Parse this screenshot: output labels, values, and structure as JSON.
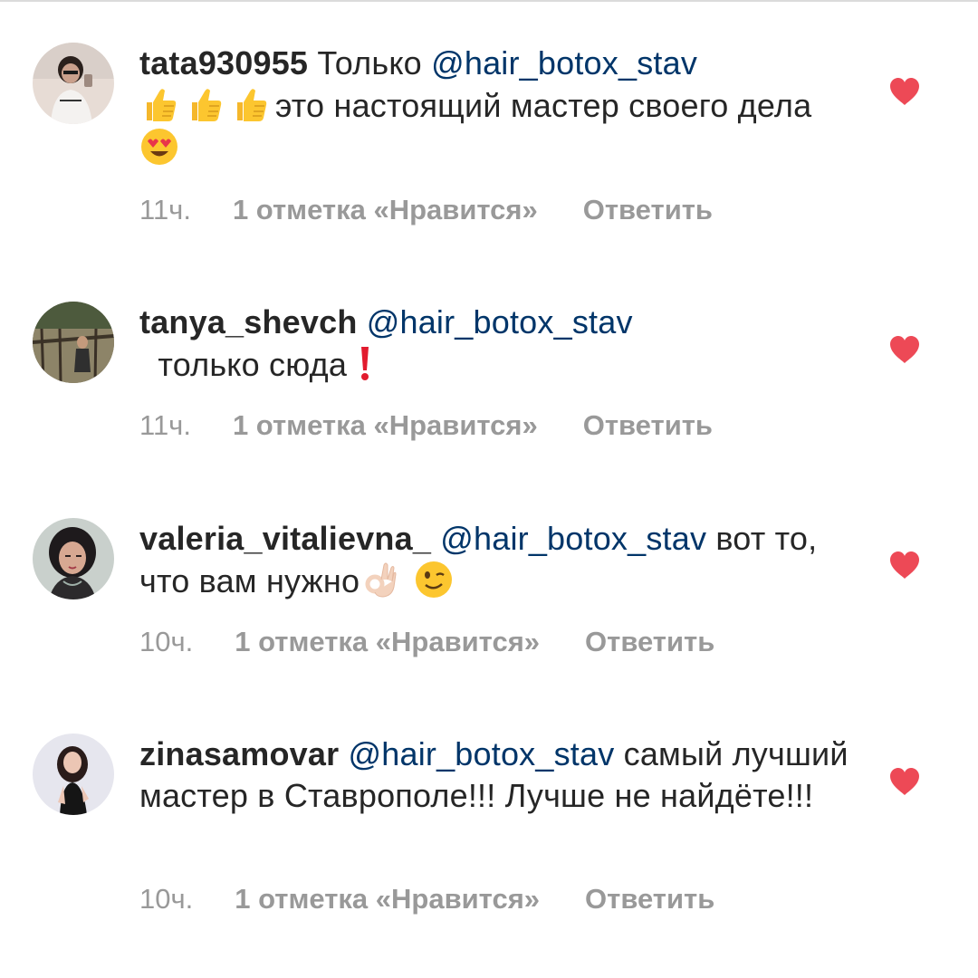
{
  "comments": [
    {
      "username": "tata930955",
      "parts": [
        {
          "kind": "text",
          "value": " Только "
        },
        {
          "kind": "mention",
          "value": "@hair_botox_stav"
        },
        {
          "kind": "text",
          "value": " "
        },
        {
          "kind": "emoji",
          "icon": "thumbs-up-icon"
        },
        {
          "kind": "emoji",
          "icon": "thumbs-up-icon"
        },
        {
          "kind": "emoji",
          "icon": "thumbs-up-icon"
        },
        {
          "kind": "text",
          "value": "это настоящий мастер своего дела "
        },
        {
          "kind": "emoji",
          "icon": "heart-eyes-icon"
        }
      ],
      "time": "11ч.",
      "likes": "1 отметка «Нравится»",
      "reply": "Ответить",
      "liked": true
    },
    {
      "username": "tanya_shevch",
      "parts": [
        {
          "kind": "text",
          "value": " "
        },
        {
          "kind": "mention",
          "value": "@hair_botox_stav"
        },
        {
          "kind": "text",
          "value": "  только сюда "
        },
        {
          "kind": "emoji",
          "icon": "exclamation-icon"
        }
      ],
      "time": "11ч.",
      "likes": "1 отметка «Нравится»",
      "reply": "Ответить",
      "liked": true
    },
    {
      "username": "valeria_vitalievna_",
      "parts": [
        {
          "kind": "text",
          "value": " "
        },
        {
          "kind": "mention",
          "value": "@hair_botox_stav"
        },
        {
          "kind": "text",
          "value": " вот то, что вам нужно"
        },
        {
          "kind": "emoji",
          "icon": "ok-hand-icon"
        },
        {
          "kind": "text",
          "value": " "
        },
        {
          "kind": "emoji",
          "icon": "wink-icon"
        }
      ],
      "time": "10ч.",
      "likes": "1 отметка «Нравится»",
      "reply": "Ответить",
      "liked": true
    },
    {
      "username": "zinasamovar",
      "parts": [
        {
          "kind": "text",
          "value": " "
        },
        {
          "kind": "mention",
          "value": "@hair_botox_stav"
        },
        {
          "kind": "text",
          "value": " самый лучший мастер в Ставрополе!!! Лучше не найдёте!!!"
        }
      ],
      "time": "10ч.",
      "likes": "1 отметка «Нравится»",
      "reply": "Ответить",
      "liked": true
    }
  ],
  "colors": {
    "username": "#262626",
    "mention": "#003569",
    "meta": "#999999",
    "heart": "#ed4956"
  }
}
